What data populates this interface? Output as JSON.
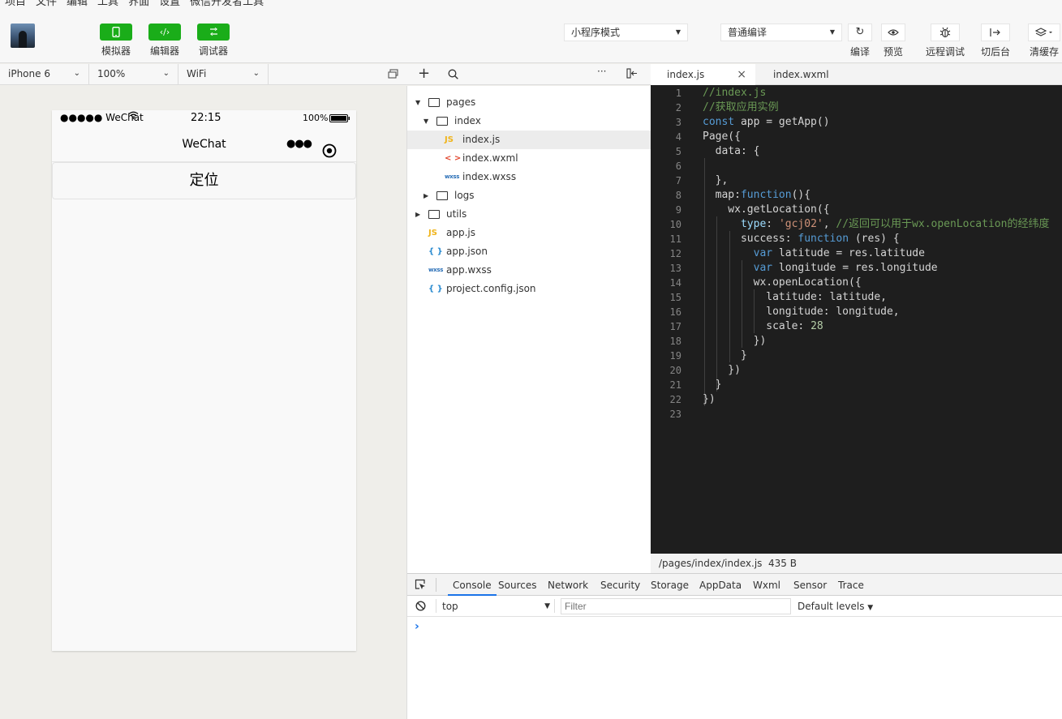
{
  "menu": [
    "项目",
    "文件",
    "编辑",
    "工具",
    "界面",
    "设置",
    "微信开发者工具"
  ],
  "toolbar": {
    "simulator_label": "模拟器",
    "editor_label": "编辑器",
    "debugger_label": "调试器",
    "mode_select": "小程序模式",
    "compile_select": "普通编译",
    "compile_label": "编译",
    "preview_label": "预览",
    "remote_debug_label": "远程调试",
    "background_label": "切后台",
    "clear_cache_label": "清缓存"
  },
  "simulator": {
    "device": "iPhone 6",
    "zoom": "100%",
    "network": "WiFi",
    "status_carrier": "●●●●● WeChat",
    "status_time": "22:15",
    "status_battery": "100%",
    "nav_title": "WeChat",
    "button_label": "定位"
  },
  "file_tree": {
    "items": [
      {
        "name": "pages",
        "type": "folder",
        "open": true,
        "depth": 0
      },
      {
        "name": "index",
        "type": "folder",
        "open": true,
        "depth": 1
      },
      {
        "name": "index.js",
        "type": "js",
        "icon": "JS",
        "depth": 2,
        "selected": true
      },
      {
        "name": "index.wxml",
        "type": "wxml",
        "icon": "< >",
        "depth": 2
      },
      {
        "name": "index.wxss",
        "type": "wxss",
        "icon": "wxss",
        "depth": 2
      },
      {
        "name": "logs",
        "type": "folder",
        "open": false,
        "depth": 1
      },
      {
        "name": "utils",
        "type": "folder",
        "open": false,
        "depth": 0
      },
      {
        "name": "app.js",
        "type": "js",
        "icon": "JS",
        "depth": 0
      },
      {
        "name": "app.json",
        "type": "json",
        "icon": "{ }",
        "depth": 0
      },
      {
        "name": "app.wxss",
        "type": "wxss",
        "icon": "wxss",
        "depth": 0
      },
      {
        "name": "project.config.json",
        "type": "json",
        "icon": "{ }",
        "depth": 0
      }
    ]
  },
  "editor": {
    "tabs": [
      "index.js",
      "index.wxml"
    ],
    "active_tab": "index.js",
    "file_path": "/pages/index/index.js",
    "file_size": "435 B",
    "line_numbers": [
      "1",
      "2",
      "3",
      "4",
      "5",
      "6",
      "7",
      "8",
      "9",
      "10",
      "11",
      "12",
      "13",
      "14",
      "15",
      "16",
      "17",
      "18",
      "19",
      "20",
      "21",
      "22",
      "23"
    ],
    "code_lines": [
      [
        {
          "t": "//index.js",
          "c": "comment"
        }
      ],
      [
        {
          "t": "//获取应用实例",
          "c": "comment"
        }
      ],
      [
        {
          "t": "const",
          "c": "kw"
        },
        {
          "t": " app = getApp()",
          "c": "plain"
        }
      ],
      [
        {
          "t": "Page({",
          "c": "plain"
        }
      ],
      [
        {
          "t": "  data: {",
          "c": "plain"
        }
      ],
      [
        {
          "t": "",
          "c": "plain"
        }
      ],
      [
        {
          "t": "  },",
          "c": "plain"
        }
      ],
      [
        {
          "t": "  map:",
          "c": "plain"
        },
        {
          "t": "function",
          "c": "kw"
        },
        {
          "t": "(){",
          "c": "plain"
        }
      ],
      [
        {
          "t": "    wx.getLocation({",
          "c": "plain"
        }
      ],
      [
        {
          "t": "      ",
          "c": "plain"
        },
        {
          "t": "type",
          "c": "prop"
        },
        {
          "t": ": ",
          "c": "plain"
        },
        {
          "t": "'gcj02'",
          "c": "str"
        },
        {
          "t": ", ",
          "c": "plain"
        },
        {
          "t": "//返回可以用于wx.openLocation的经纬度",
          "c": "comment"
        }
      ],
      [
        {
          "t": "      success: ",
          "c": "plain"
        },
        {
          "t": "function",
          "c": "kw"
        },
        {
          "t": " (res) {",
          "c": "plain"
        }
      ],
      [
        {
          "t": "        ",
          "c": "plain"
        },
        {
          "t": "var",
          "c": "kw"
        },
        {
          "t": " latitude = res.latitude",
          "c": "plain"
        }
      ],
      [
        {
          "t": "        ",
          "c": "plain"
        },
        {
          "t": "var",
          "c": "kw"
        },
        {
          "t": " longitude = res.longitude",
          "c": "plain"
        }
      ],
      [
        {
          "t": "        wx.openLocation({",
          "c": "plain"
        }
      ],
      [
        {
          "t": "          latitude: latitude,",
          "c": "plain"
        }
      ],
      [
        {
          "t": "          longitude: longitude,",
          "c": "plain"
        }
      ],
      [
        {
          "t": "          scale: ",
          "c": "plain"
        },
        {
          "t": "28",
          "c": "num"
        }
      ],
      [
        {
          "t": "        })",
          "c": "plain"
        }
      ],
      [
        {
          "t": "      }",
          "c": "plain"
        }
      ],
      [
        {
          "t": "    })",
          "c": "plain"
        }
      ],
      [
        {
          "t": "  }",
          "c": "plain"
        }
      ],
      [
        {
          "t": "})",
          "c": "plain"
        }
      ],
      [
        {
          "t": "",
          "c": "plain"
        }
      ]
    ],
    "colors": {
      "comment": "#6a9955",
      "kw": "#569cd6",
      "str": "#ce9178",
      "num": "#b5cea8",
      "prop": "#9cdcfe",
      "plain": "#d4d4d4"
    }
  },
  "devtools": {
    "tabs": [
      "Console",
      "Sources",
      "Network",
      "Security",
      "Storage",
      "AppData",
      "Wxml",
      "Sensor",
      "Trace"
    ],
    "active_tab": "Console",
    "context": "top",
    "filter_placeholder": "Filter",
    "levels": "Default levels",
    "prompt": "›"
  },
  "colors": {
    "brand_green": "#1aad19",
    "editor_bg": "#1e1e1e"
  }
}
